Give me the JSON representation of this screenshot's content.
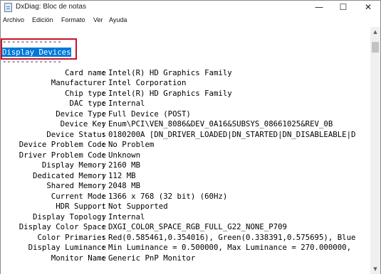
{
  "window": {
    "title": "DxDiag: Bloc de notas",
    "controls": {
      "minimize": "—",
      "maximize": "☐",
      "close": "✕"
    }
  },
  "menu": [
    "Archivo",
    "Edición",
    "Formato",
    "Ver",
    "Ayuda"
  ],
  "document": {
    "separator_top": "-------------",
    "section_title": "Display Devices",
    "separator_bottom": "-------------",
    "fields": [
      {
        "key": "Card name",
        "value": "Intel(R) HD Graphics Family"
      },
      {
        "key": "Manufacturer",
        "value": "Intel Corporation"
      },
      {
        "key": "Chip type",
        "value": "Intel(R) HD Graphics Family"
      },
      {
        "key": "DAC type",
        "value": "Internal"
      },
      {
        "key": "Device Type",
        "value": "Full Device (POST)"
      },
      {
        "key": "Device Key",
        "value": "Enum\\PCI\\VEN_8086&DEV_0A16&SUBSYS_08661025&REV_0B"
      },
      {
        "key": "Device Status",
        "value": "0180200A [DN_DRIVER_LOADED|DN_STARTED|DN_DISABLEABLE|D"
      },
      {
        "key": "Device Problem Code",
        "value": "No Problem"
      },
      {
        "key": "Driver Problem Code",
        "value": "Unknown"
      },
      {
        "key": "Display Memory",
        "value": "2160 MB"
      },
      {
        "key": "Dedicated Memory",
        "value": "112 MB"
      },
      {
        "key": "Shared Memory",
        "value": "2048 MB"
      },
      {
        "key": "Current Mode",
        "value": "1366 x 768 (32 bit) (60Hz)"
      },
      {
        "key": "HDR Support",
        "value": "Not Supported"
      },
      {
        "key": "Display Topology",
        "value": "Internal"
      },
      {
        "key": "Display Color Space",
        "value": "DXGI_COLOR_SPACE_RGB_FULL_G22_NONE_P709"
      },
      {
        "key": "Color Primaries",
        "value": "Red(0.585461,0.354016), Green(0.338391,0.575695), Blue"
      },
      {
        "key": "Display Luminance",
        "value": "Min Luminance = 0.500000, Max Luminance = 270.000000,"
      },
      {
        "key": "Monitor Name",
        "value": "Generic PnP Monitor"
      }
    ]
  },
  "scrollbar": {
    "up_icon": "chevron-up-icon",
    "down_icon": "chevron-down-icon"
  },
  "colors": {
    "selection": "#0078d7",
    "annotation_border": "#c8102e"
  }
}
